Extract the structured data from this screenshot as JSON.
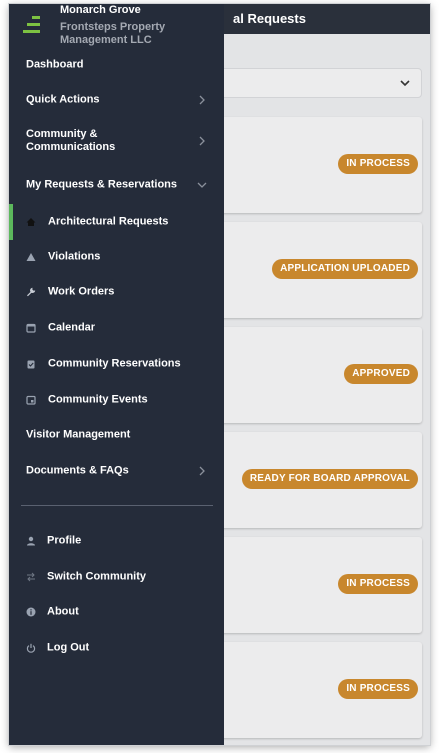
{
  "app": {
    "header_title": "al Requests",
    "cards": [
      {
        "status": "IN PROCESS"
      },
      {
        "status": "APPLICATION UPLOADED"
      },
      {
        "status": "APPROVED"
      },
      {
        "status": "READY FOR BOARD APPROVAL"
      },
      {
        "status": "IN PROCESS"
      },
      {
        "status": "IN PROCESS"
      }
    ],
    "colors": {
      "badge": "#c8872d",
      "header": "#2a303b",
      "drawer": "#252c3a",
      "active": "#5cb85c"
    }
  },
  "drawer": {
    "community_name": "Monarch Grove",
    "company_name": "Frontsteps Property Management LLC",
    "items": {
      "dashboard": "Dashboard",
      "quick_actions": "Quick Actions",
      "community_comms": "Community & Communications",
      "my_requests": "My Requests & Reservations",
      "architectural": "Architectural Requests",
      "violations": "Violations",
      "work_orders": "Work Orders",
      "calendar": "Calendar",
      "community_reservations": "Community Reservations",
      "community_events": "Community Events",
      "visitor_management": "Visitor Management",
      "documents": "Documents & FAQs",
      "profile": "Profile",
      "switch_community": "Switch Community",
      "about": "About",
      "logout": "Log Out"
    },
    "icons": [
      "home-icon",
      "warning-icon",
      "wrench-icon",
      "calendar-icon",
      "clipboard-icon",
      "event-icon",
      "person-icon",
      "switch-icon",
      "info-icon",
      "power-icon"
    ]
  }
}
